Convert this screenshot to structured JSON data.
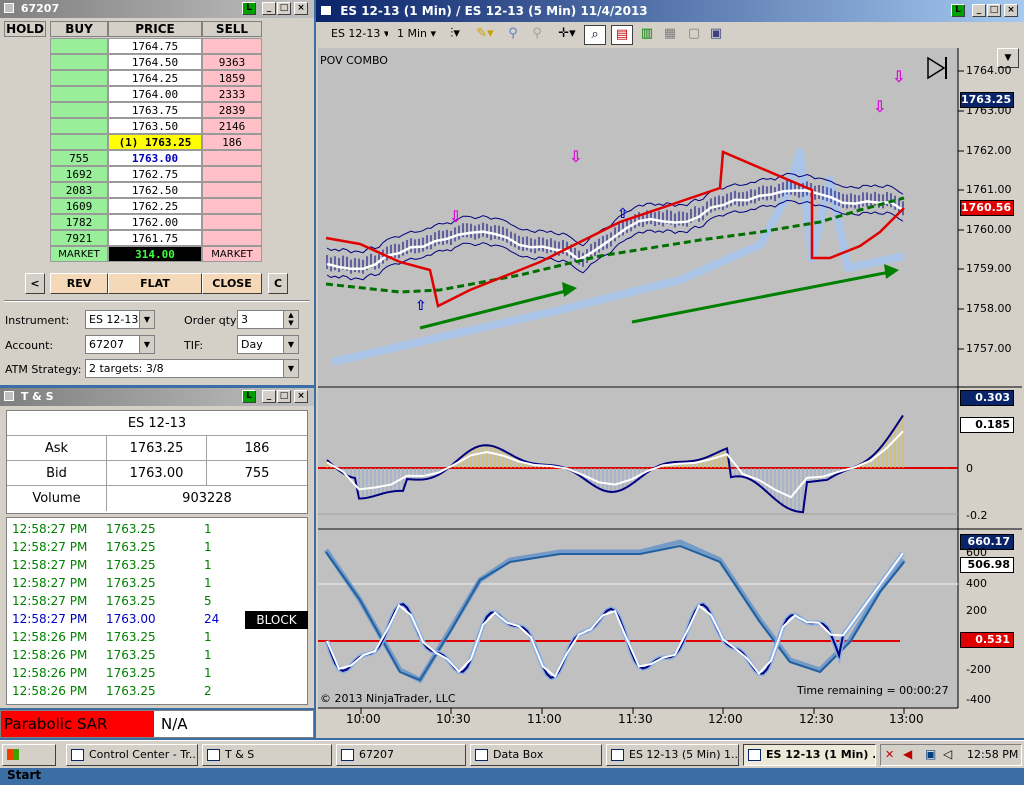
{
  "dom": {
    "title": "67207",
    "headers": [
      "HOLD",
      "BUY",
      "PRICE",
      "SELL"
    ],
    "rows": [
      {
        "buy": "",
        "price": "1764.75",
        "sell": ""
      },
      {
        "buy": "",
        "price": "1764.50",
        "sell": "9363"
      },
      {
        "buy": "",
        "price": "1764.25",
        "sell": "1859"
      },
      {
        "buy": "",
        "price": "1764.00",
        "sell": "2333"
      },
      {
        "buy": "",
        "price": "1763.75",
        "sell": "2839"
      },
      {
        "buy": "",
        "price": "1763.50",
        "sell": "2146"
      },
      {
        "buy": "",
        "price": "(1) 1763.25",
        "sell": "186"
      },
      {
        "buy": "755",
        "price": "1763.00",
        "sell": ""
      },
      {
        "buy": "1692",
        "price": "1762.75",
        "sell": ""
      },
      {
        "buy": "2083",
        "price": "1762.50",
        "sell": ""
      },
      {
        "buy": "1609",
        "price": "1762.25",
        "sell": ""
      },
      {
        "buy": "1782",
        "price": "1762.00",
        "sell": ""
      },
      {
        "buy": "7921",
        "price": "1761.75",
        "sell": ""
      }
    ],
    "market_buy": "MARKET",
    "pnl": "314.00",
    "market_sell": "MARKET",
    "left_btn": "<",
    "rev": "REV",
    "flat": "FLAT",
    "close": "CLOSE",
    "c_btn": "C",
    "instrument_label": "Instrument:",
    "instrument": "ES 12-13",
    "orderqty_label": "Order qty:",
    "orderqty": "3",
    "account_label": "Account:",
    "account": "67207",
    "tif_label": "TIF:",
    "tif": "Day",
    "atm_label": "ATM Strategy:",
    "atm": "2 targets: 3/8"
  },
  "ts": {
    "title": "T & S",
    "instrument": "ES 12-13",
    "ask_label": "Ask",
    "ask_price": "1763.25",
    "ask_size": "186",
    "bid_label": "Bid",
    "bid_price": "1763.00",
    "bid_size": "755",
    "vol_label": "Volume",
    "volume": "903228",
    "rows": [
      {
        "time": "12:58:27 PM",
        "price": "1763.25",
        "size": "1",
        "tag": ""
      },
      {
        "time": "12:58:27 PM",
        "price": "1763.25",
        "size": "1",
        "tag": ""
      },
      {
        "time": "12:58:27 PM",
        "price": "1763.25",
        "size": "1",
        "tag": ""
      },
      {
        "time": "12:58:27 PM",
        "price": "1763.25",
        "size": "1",
        "tag": ""
      },
      {
        "time": "12:58:27 PM",
        "price": "1763.25",
        "size": "5",
        "tag": ""
      },
      {
        "time": "12:58:27 PM",
        "price": "1763.00",
        "size": "24",
        "tag": "BLOCK"
      },
      {
        "time": "12:58:26 PM",
        "price": "1763.25",
        "size": "1",
        "tag": ""
      },
      {
        "time": "12:58:26 PM",
        "price": "1763.25",
        "size": "1",
        "tag": ""
      },
      {
        "time": "12:58:26 PM",
        "price": "1763.25",
        "size": "1",
        "tag": ""
      },
      {
        "time": "12:58:26 PM",
        "price": "1763.25",
        "size": "2",
        "tag": ""
      }
    ]
  },
  "psar": {
    "label": "Parabolic SAR",
    "value": "N/A"
  },
  "chart": {
    "title": "ES 12-13 (1 Min) / ES 12-13 (5 Min)  11/4/2013",
    "instrument": "ES 12-13",
    "interval": "1 Min",
    "indicator_label": "POV COMBO",
    "price_ticks": [
      "1764.00",
      "1763.00",
      "1762.00",
      "1761.00",
      "1760.00",
      "1759.00",
      "1758.00",
      "1757.00"
    ],
    "last_price": "1763.25",
    "red_flag": "1760.56",
    "osc_ticks": [
      "0",
      "-0.2"
    ],
    "osc_flag1": "0.303",
    "osc_flag2": "0.185",
    "stoch_ticks": [
      "600",
      "400",
      "200",
      "0",
      "-200",
      "-400"
    ],
    "stoch_flag1": "660.17",
    "stoch_flag2": "506.98",
    "stoch_flag3": "0.531",
    "x_ticks": [
      "10:00",
      "10:30",
      "11:00",
      "11:30",
      "12:00",
      "12:30",
      "13:00"
    ],
    "copyright": "© 2013 NinjaTrader, LLC",
    "time_remaining": "Time remaining = 00:00:27"
  },
  "taskbar": {
    "start": "Start",
    "items": [
      "Control Center - Tr...",
      "T & S",
      "67207",
      "Data Box",
      "ES 12-13 (5 Min)  1...",
      "ES 12-13 (1 Min) ..."
    ],
    "clock": "12:58 PM"
  }
}
